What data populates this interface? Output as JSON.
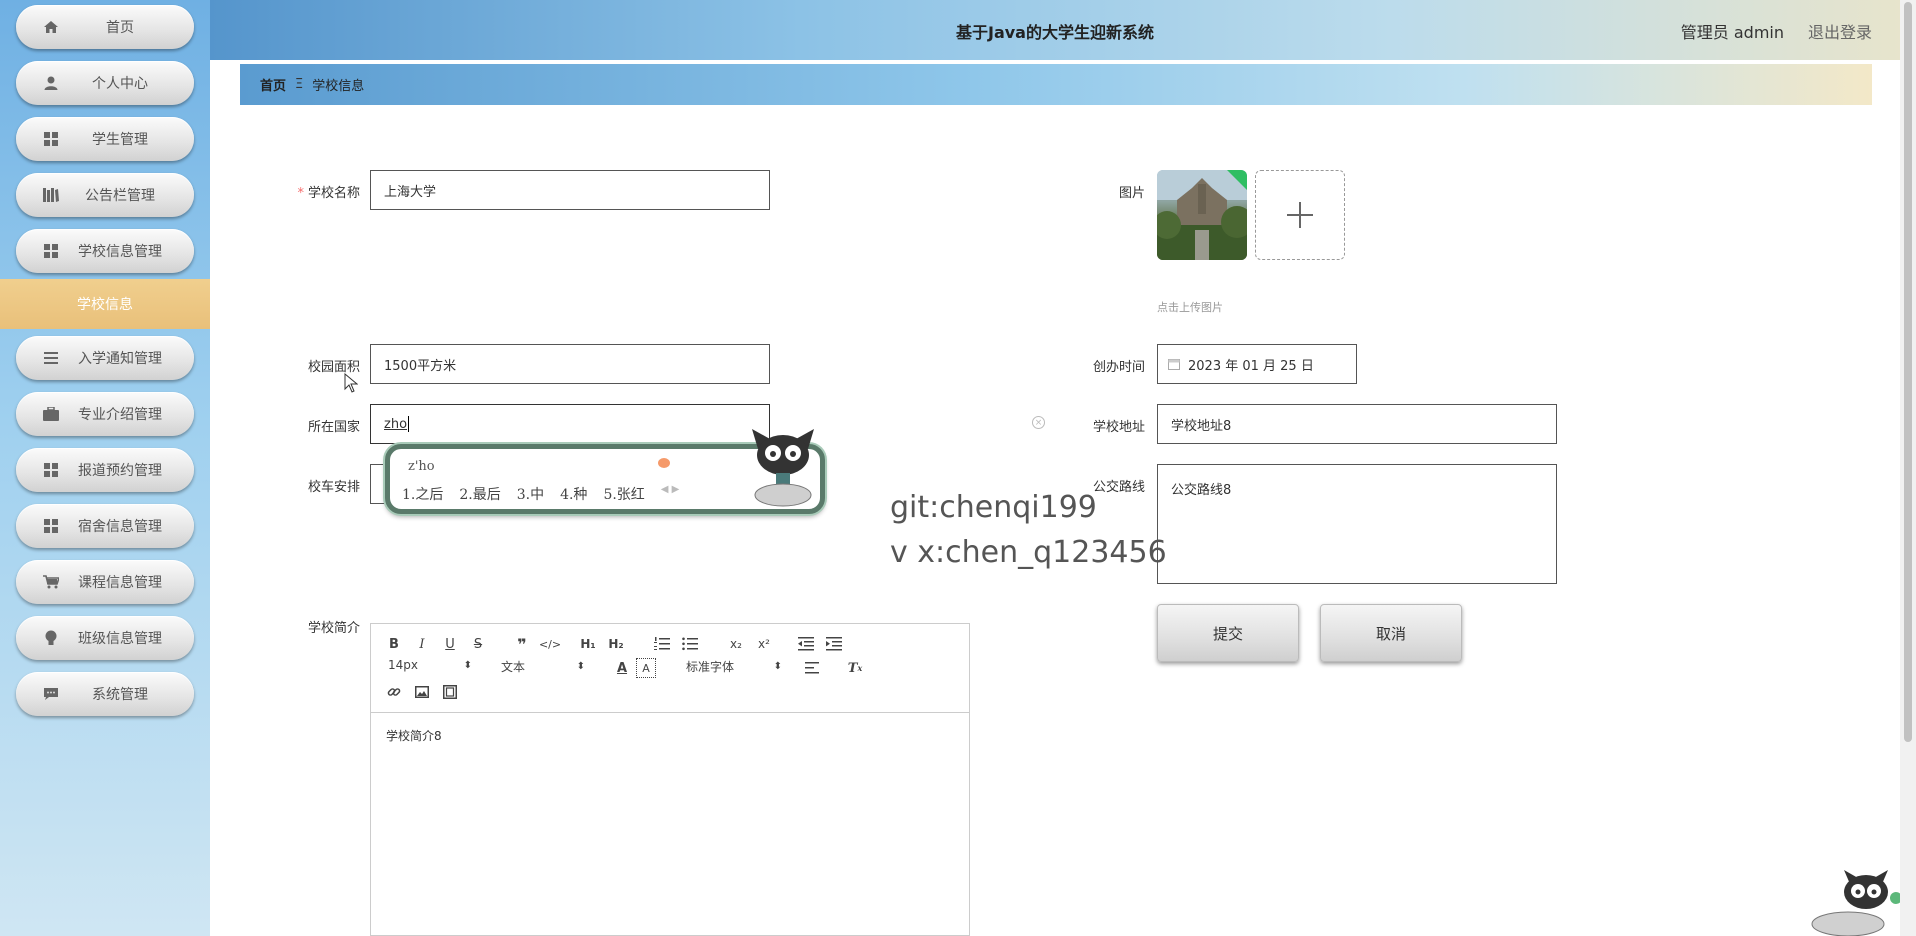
{
  "header": {
    "title": "基于Java的大学生迎新系统",
    "user": "管理员 admin",
    "logout": "退出登录"
  },
  "sidebar": {
    "items": [
      {
        "label": "首页",
        "icon": "home-icon"
      },
      {
        "label": "个人中心",
        "icon": "user-icon"
      },
      {
        "label": "学生管理",
        "icon": "grid-icon"
      },
      {
        "label": "公告栏管理",
        "icon": "book-icon"
      },
      {
        "label": "学校信息管理",
        "icon": "grid-icon"
      },
      {
        "label": "入学通知管理",
        "icon": "list-icon"
      },
      {
        "label": "专业介绍管理",
        "icon": "briefcase-icon"
      },
      {
        "label": "报道预约管理",
        "icon": "grid-icon"
      },
      {
        "label": "宿舍信息管理",
        "icon": "grid-icon"
      },
      {
        "label": "课程信息管理",
        "icon": "cart-icon"
      },
      {
        "label": "班级信息管理",
        "icon": "bulb-icon"
      },
      {
        "label": "系统管理",
        "icon": "chat-icon"
      }
    ],
    "sub_item": "学校信息"
  },
  "breadcrumb": {
    "home": "首页",
    "sep": "Ξ",
    "current": "学校信息"
  },
  "form": {
    "school_name_label": "学校名称",
    "school_name_value": "上海大学",
    "image_label": "图片",
    "upload_hint": "点击上传图片",
    "area_label": "校园面积",
    "area_value": "1500平方米",
    "founded_label": "创办时间",
    "founded_value": "2023 年 01 月 25 日",
    "country_label": "所在国家",
    "country_value": "zho",
    "address_label": "学校地址",
    "address_value": "学校地址8",
    "bus_label": "校车安排",
    "route_label": "公交路线",
    "route_value": "公交路线8",
    "intro_label": "学校简介",
    "intro_value": "学校简介8",
    "submit": "提交",
    "cancel": "取消"
  },
  "editor": {
    "font_size": "14px",
    "block_type": "文本",
    "font_family": "标准字体"
  },
  "ime": {
    "pinyin": "z'ho",
    "candidates": [
      "1.之后",
      "2.最后",
      "3.中",
      "4.种",
      "5.张红"
    ]
  },
  "watermark": {
    "line1": "git:chenqi199",
    "line2": "v x:chen_q123456"
  },
  "colors": {
    "required": "#f56c6c",
    "sidebar_active": "#e9c07a"
  }
}
